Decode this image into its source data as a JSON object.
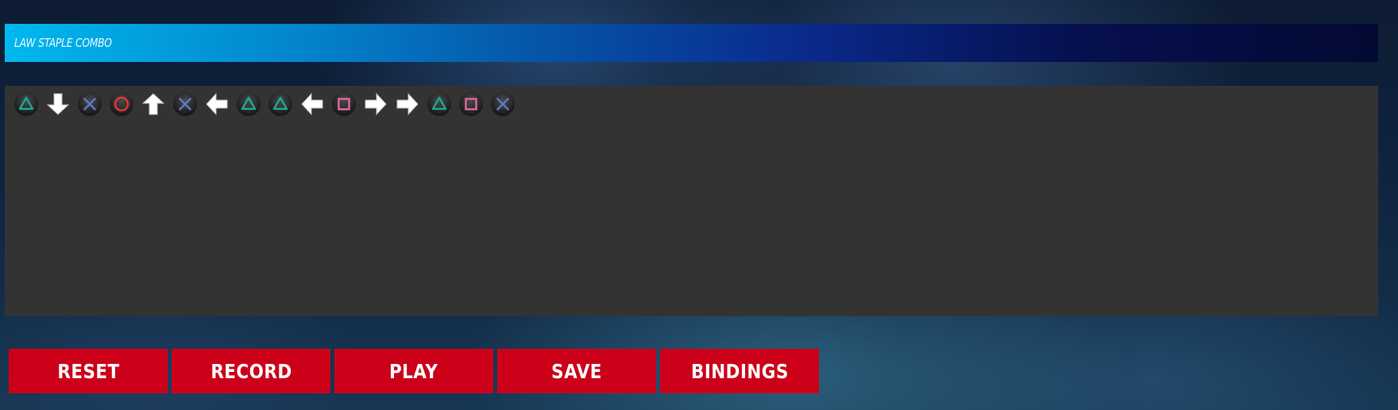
{
  "title": "LAW STAPLE COMBO",
  "colors": {
    "triangle": "#1ea896",
    "cross": "#5a78c4",
    "circle": "#e0323c",
    "square": "#e466a0",
    "arrow": "#ffffff",
    "button_bg": "#cc0019"
  },
  "sequence": [
    {
      "kind": "triangle",
      "icon": "triangle-icon"
    },
    {
      "kind": "down",
      "icon": "arrow-down-icon"
    },
    {
      "kind": "cross",
      "icon": "cross-icon"
    },
    {
      "kind": "circle",
      "icon": "circle-icon"
    },
    {
      "kind": "up",
      "icon": "arrow-up-icon"
    },
    {
      "kind": "cross",
      "icon": "cross-icon"
    },
    {
      "kind": "left",
      "icon": "arrow-left-icon"
    },
    {
      "kind": "triangle",
      "icon": "triangle-icon"
    },
    {
      "kind": "triangle",
      "icon": "triangle-icon"
    },
    {
      "kind": "left",
      "icon": "arrow-left-icon"
    },
    {
      "kind": "square",
      "icon": "square-icon"
    },
    {
      "kind": "right",
      "icon": "arrow-right-icon"
    },
    {
      "kind": "right",
      "icon": "arrow-right-icon"
    },
    {
      "kind": "triangle",
      "icon": "triangle-icon"
    },
    {
      "kind": "square",
      "icon": "square-icon"
    },
    {
      "kind": "cross",
      "icon": "cross-icon"
    }
  ],
  "buttons": {
    "reset": "RESET",
    "record": "RECORD",
    "play": "PLAY",
    "save": "SAVE",
    "bindings": "BINDINGS"
  }
}
